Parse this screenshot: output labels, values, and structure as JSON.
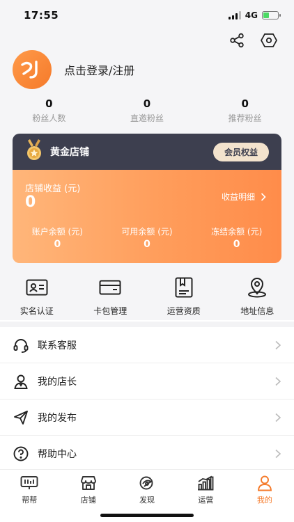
{
  "status_bar": {
    "time": "17:55",
    "network": "4G"
  },
  "profile": {
    "login_text": "点击登录/注册"
  },
  "stats": [
    {
      "value": "0",
      "label": "粉丝人数"
    },
    {
      "value": "0",
      "label": "直邀粉丝"
    },
    {
      "value": "0",
      "label": "推荐粉丝"
    }
  ],
  "shop": {
    "level": "黄金店铺",
    "member_button": "会员权益",
    "income_label": "店铺收益 (元)",
    "income_value": "0",
    "income_detail": "收益明细",
    "balances": [
      {
        "label": "账户余额 (元)",
        "value": "0"
      },
      {
        "label": "可用余额 (元)",
        "value": "0"
      },
      {
        "label": "冻结余额 (元)",
        "value": "0"
      }
    ]
  },
  "quick_actions": [
    {
      "label": "实名认证",
      "icon": "id-card-icon"
    },
    {
      "label": "卡包管理",
      "icon": "card-wallet-icon"
    },
    {
      "label": "运营资质",
      "icon": "qualification-icon"
    },
    {
      "label": "地址信息",
      "icon": "location-icon"
    }
  ],
  "menu": [
    {
      "label": "联系客服",
      "icon": "headset-icon"
    },
    {
      "label": "我的店长",
      "icon": "person-icon"
    },
    {
      "label": "我的发布",
      "icon": "send-icon"
    },
    {
      "label": "帮助中心",
      "icon": "help-icon"
    }
  ],
  "tabs": [
    {
      "label": "帮帮",
      "icon": "helper-icon"
    },
    {
      "label": "店铺",
      "icon": "store-icon"
    },
    {
      "label": "发现",
      "icon": "discover-icon"
    },
    {
      "label": "运营",
      "icon": "chart-icon"
    },
    {
      "label": "我的",
      "icon": "profile-icon",
      "active": true
    }
  ],
  "colors": {
    "accent": "#f57a2a",
    "card_dark": "#3d3f4f",
    "member_badge": "#f3e3cd"
  }
}
